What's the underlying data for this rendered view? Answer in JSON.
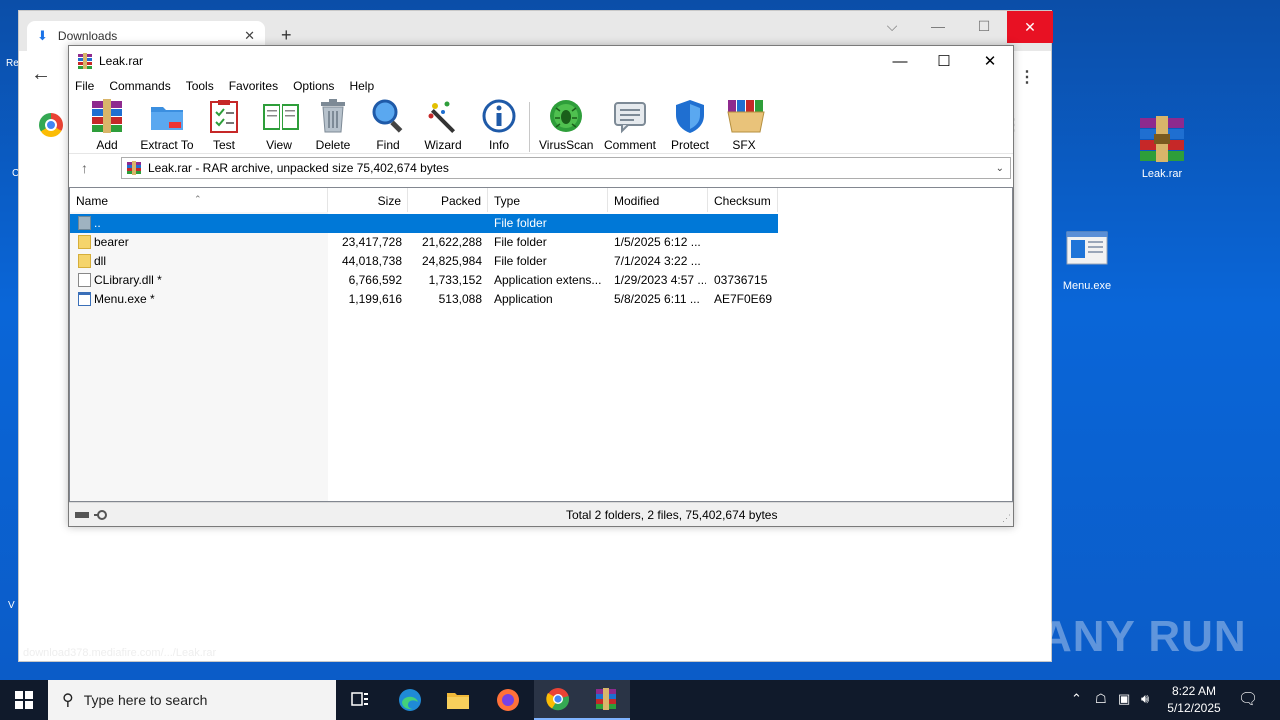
{
  "desktop": {
    "icons": [
      {
        "label": "Leak.rar"
      },
      {
        "label": "Menu.exe"
      }
    ],
    "left_partial_labels": [
      "Re",
      "C",
      "V"
    ]
  },
  "chrome": {
    "tab_title": "Downloads",
    "status_url": "download378.mediafire.com/.../Leak.rar"
  },
  "winrar": {
    "title": "Leak.rar",
    "menu": [
      "File",
      "Commands",
      "Tools",
      "Favorites",
      "Options",
      "Help"
    ],
    "toolbar": {
      "add": "Add",
      "extract": "Extract To",
      "test": "Test",
      "view": "View",
      "delete": "Delete",
      "find": "Find",
      "wizard": "Wizard",
      "info": "Info",
      "virusscan": "VirusScan",
      "comment": "Comment",
      "protect": "Protect",
      "sfx": "SFX"
    },
    "address": "Leak.rar - RAR archive, unpacked size 75,402,674 bytes",
    "columns": {
      "name": "Name",
      "size": "Size",
      "packed": "Packed",
      "type": "Type",
      "modified": "Modified",
      "checksum": "Checksum"
    },
    "rows": [
      {
        "name": "..",
        "size": "",
        "packed": "",
        "type": "File folder",
        "modified": "",
        "checksum": ""
      },
      {
        "name": "bearer",
        "size": "23,417,728",
        "packed": "21,622,288",
        "type": "File folder",
        "modified": "1/5/2025 6:12 ...",
        "checksum": ""
      },
      {
        "name": "dll",
        "size": "44,018,738",
        "packed": "24,825,984",
        "type": "File folder",
        "modified": "7/1/2024 3:22 ...",
        "checksum": ""
      },
      {
        "name": "CLibrary.dll *",
        "size": "6,766,592",
        "packed": "1,733,152",
        "type": "Application extens...",
        "modified": "1/29/2023 4:57 ...",
        "checksum": "03736715"
      },
      {
        "name": "Menu.exe *",
        "size": "1,199,616",
        "packed": "513,088",
        "type": "Application",
        "modified": "5/8/2025 6:11 ...",
        "checksum": "AE7F0E69"
      }
    ],
    "status": "Total 2 folders, 2 files, 75,402,674 bytes"
  },
  "watermark": "ANY RUN",
  "taskbar": {
    "search_placeholder": "Type here to search",
    "time": "8:22 AM",
    "date": "5/12/2025"
  }
}
